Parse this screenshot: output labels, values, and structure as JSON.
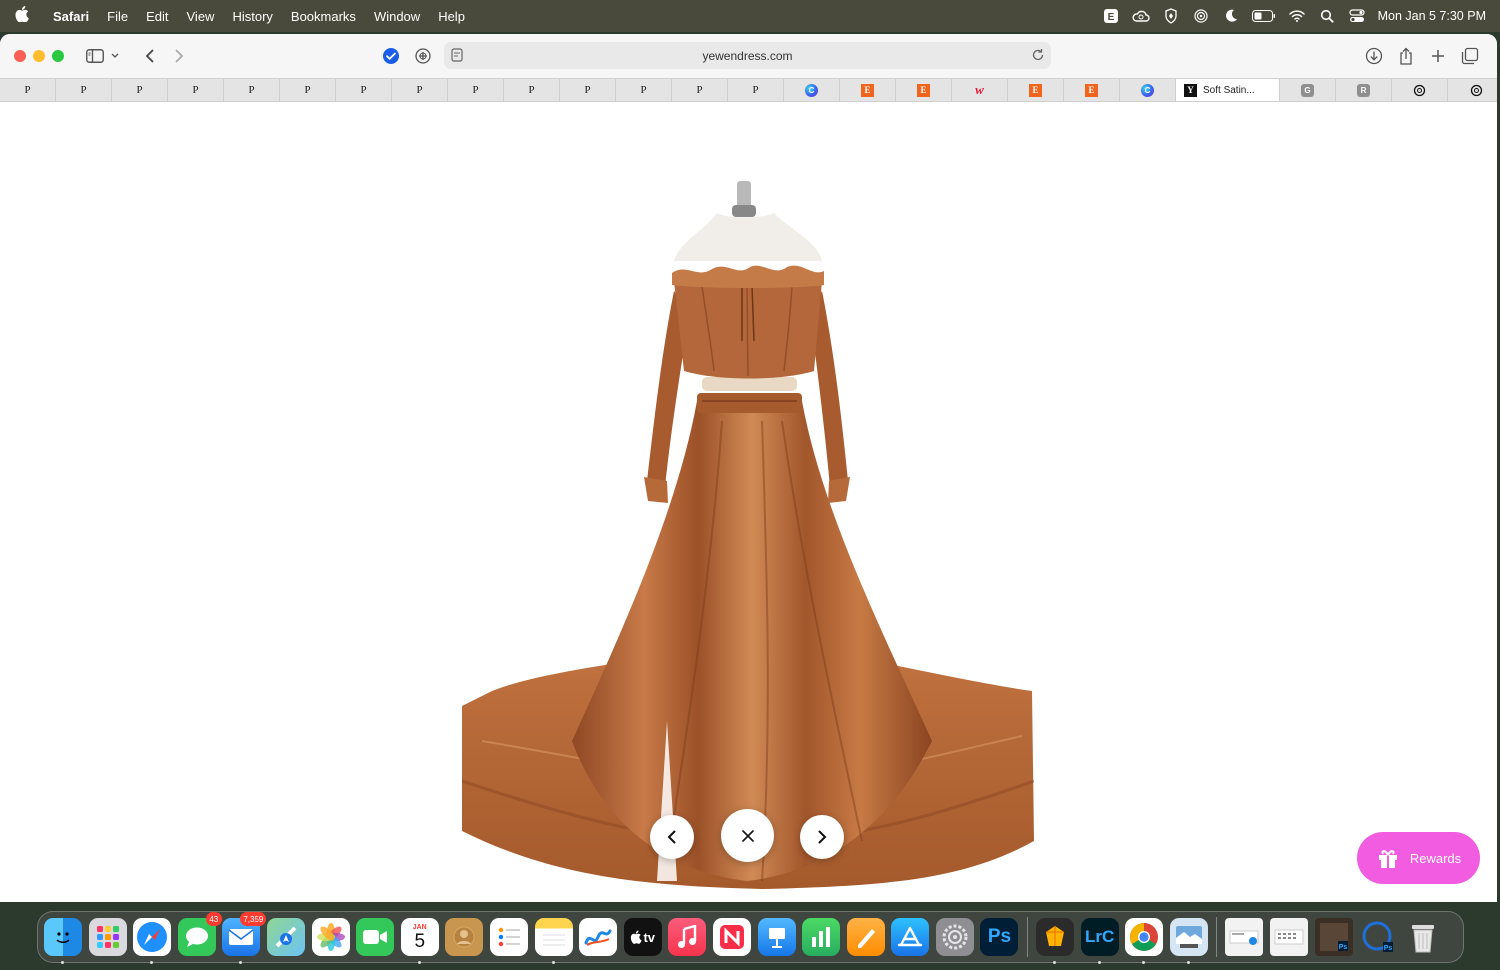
{
  "menubar": {
    "app_name": "Safari",
    "menus": [
      "File",
      "Edit",
      "View",
      "History",
      "Bookmarks",
      "Window",
      "Help"
    ],
    "clock": "Mon Jan 5  7:30 PM"
  },
  "toolbar": {
    "url": "yewendress.com"
  },
  "tabs": {
    "pinned_p_label": "P",
    "e_label": "E",
    "w_label": "w",
    "c_label": "C",
    "y_label": "Y",
    "active_title": "Soft Satin...",
    "g_label": "G",
    "r_label": "R"
  },
  "content": {
    "rewards_label": "Rewards",
    "dress_color": "#b15f30"
  },
  "dock": {
    "messages_badge": "43",
    "mail_badge": "7,359",
    "calendar_month": "JAN",
    "calendar_day": "5",
    "tv_label": "tv",
    "ps_label": "Ps",
    "lrc_label": "LrC"
  },
  "colors": {
    "menubar": "#4a4a3c",
    "rewards": "#f25ce0",
    "traffic_close": "#ff5f57",
    "traffic_min": "#febc2e",
    "traffic_max": "#28c840"
  }
}
